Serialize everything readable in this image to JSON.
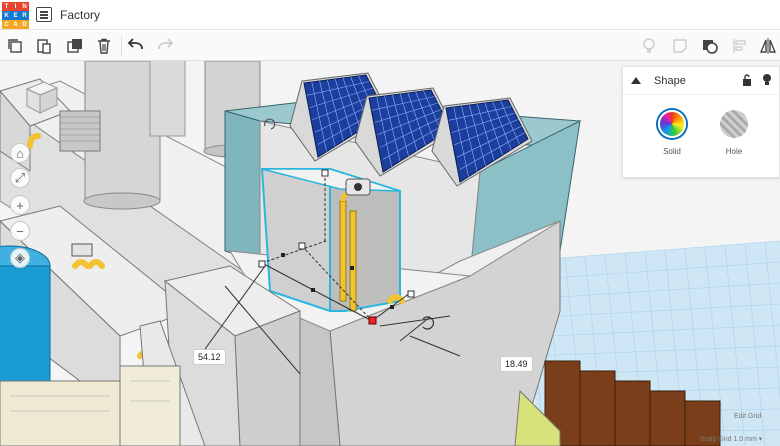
{
  "app": {
    "logo_letters": [
      "T",
      "I",
      "N",
      "K",
      "E",
      "R",
      "C",
      "A",
      "D"
    ],
    "logo_colors": [
      "#e8442e",
      "#e8442e",
      "#e8442e",
      "#1477d1",
      "#1477d1",
      "#1477d1",
      "#f5a623",
      "#f5a623",
      "#f5a623"
    ],
    "project_title": "Factory"
  },
  "toolbar": {
    "icons": [
      "copy-icon",
      "paste-icon",
      "duplicate-icon",
      "delete-icon",
      "undo-icon",
      "redo-icon",
      "light-bulb-icon",
      "note-icon",
      "group-icon",
      "align-icon",
      "mirror-icon"
    ]
  },
  "inspector": {
    "title": "Shape",
    "solid_label": "Solid",
    "hole_label": "Hole"
  },
  "dimensions": {
    "length": "54.12",
    "height": "18.49"
  },
  "footer": {
    "edit_grid": "Edit Grid",
    "snap_grid": "Snap Grid  1.0 mm ▾"
  },
  "colors": {
    "accent": "#0d6fb8",
    "selection_outline": "#29b6e0",
    "solar_panel": "#1c3e9c",
    "pipe": "#f2c230",
    "tank": "#1a9bd1",
    "wall": "#7fb6bd"
  }
}
